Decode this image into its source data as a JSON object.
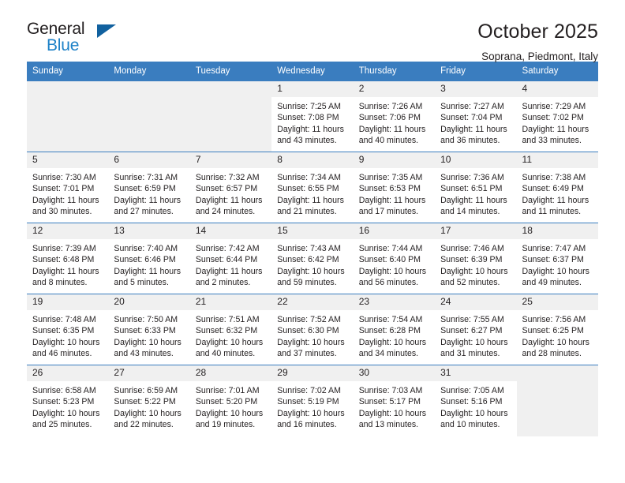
{
  "brand": {
    "word_one": "General",
    "word_two": "Blue",
    "triangle_icon": "triangle-icon"
  },
  "header": {
    "title": "October 2025",
    "location": "Soprana, Piedmont, Italy"
  },
  "colors": {
    "header_blue": "#3a7dbf",
    "brand_blue": "#1d81c7",
    "triangle_blue": "#11619f",
    "cell_band_gray": "#f0f0f0",
    "text": "#231f20"
  },
  "weekdays": [
    "Sunday",
    "Monday",
    "Tuesday",
    "Wednesday",
    "Thursday",
    "Friday",
    "Saturday"
  ],
  "labels": {
    "sunrise_prefix": "Sunrise:",
    "sunset_prefix": "Sunset:",
    "daylight_prefix": "Daylight:"
  },
  "weeks": [
    [
      {
        "day": "",
        "empty": true
      },
      {
        "day": "",
        "empty": true
      },
      {
        "day": "",
        "empty": true
      },
      {
        "day": "1",
        "sunrise": "Sunrise: 7:25 AM",
        "sunset": "Sunset: 7:08 PM",
        "daylight_line1": "Daylight: 11 hours",
        "daylight_line2": "and 43 minutes."
      },
      {
        "day": "2",
        "sunrise": "Sunrise: 7:26 AM",
        "sunset": "Sunset: 7:06 PM",
        "daylight_line1": "Daylight: 11 hours",
        "daylight_line2": "and 40 minutes."
      },
      {
        "day": "3",
        "sunrise": "Sunrise: 7:27 AM",
        "sunset": "Sunset: 7:04 PM",
        "daylight_line1": "Daylight: 11 hours",
        "daylight_line2": "and 36 minutes."
      },
      {
        "day": "4",
        "sunrise": "Sunrise: 7:29 AM",
        "sunset": "Sunset: 7:02 PM",
        "daylight_line1": "Daylight: 11 hours",
        "daylight_line2": "and 33 minutes."
      }
    ],
    [
      {
        "day": "5",
        "sunrise": "Sunrise: 7:30 AM",
        "sunset": "Sunset: 7:01 PM",
        "daylight_line1": "Daylight: 11 hours",
        "daylight_line2": "and 30 minutes."
      },
      {
        "day": "6",
        "sunrise": "Sunrise: 7:31 AM",
        "sunset": "Sunset: 6:59 PM",
        "daylight_line1": "Daylight: 11 hours",
        "daylight_line2": "and 27 minutes."
      },
      {
        "day": "7",
        "sunrise": "Sunrise: 7:32 AM",
        "sunset": "Sunset: 6:57 PM",
        "daylight_line1": "Daylight: 11 hours",
        "daylight_line2": "and 24 minutes."
      },
      {
        "day": "8",
        "sunrise": "Sunrise: 7:34 AM",
        "sunset": "Sunset: 6:55 PM",
        "daylight_line1": "Daylight: 11 hours",
        "daylight_line2": "and 21 minutes."
      },
      {
        "day": "9",
        "sunrise": "Sunrise: 7:35 AM",
        "sunset": "Sunset: 6:53 PM",
        "daylight_line1": "Daylight: 11 hours",
        "daylight_line2": "and 17 minutes."
      },
      {
        "day": "10",
        "sunrise": "Sunrise: 7:36 AM",
        "sunset": "Sunset: 6:51 PM",
        "daylight_line1": "Daylight: 11 hours",
        "daylight_line2": "and 14 minutes."
      },
      {
        "day": "11",
        "sunrise": "Sunrise: 7:38 AM",
        "sunset": "Sunset: 6:49 PM",
        "daylight_line1": "Daylight: 11 hours",
        "daylight_line2": "and 11 minutes."
      }
    ],
    [
      {
        "day": "12",
        "sunrise": "Sunrise: 7:39 AM",
        "sunset": "Sunset: 6:48 PM",
        "daylight_line1": "Daylight: 11 hours",
        "daylight_line2": "and 8 minutes."
      },
      {
        "day": "13",
        "sunrise": "Sunrise: 7:40 AM",
        "sunset": "Sunset: 6:46 PM",
        "daylight_line1": "Daylight: 11 hours",
        "daylight_line2": "and 5 minutes."
      },
      {
        "day": "14",
        "sunrise": "Sunrise: 7:42 AM",
        "sunset": "Sunset: 6:44 PM",
        "daylight_line1": "Daylight: 11 hours",
        "daylight_line2": "and 2 minutes."
      },
      {
        "day": "15",
        "sunrise": "Sunrise: 7:43 AM",
        "sunset": "Sunset: 6:42 PM",
        "daylight_line1": "Daylight: 10 hours",
        "daylight_line2": "and 59 minutes."
      },
      {
        "day": "16",
        "sunrise": "Sunrise: 7:44 AM",
        "sunset": "Sunset: 6:40 PM",
        "daylight_line1": "Daylight: 10 hours",
        "daylight_line2": "and 56 minutes."
      },
      {
        "day": "17",
        "sunrise": "Sunrise: 7:46 AM",
        "sunset": "Sunset: 6:39 PM",
        "daylight_line1": "Daylight: 10 hours",
        "daylight_line2": "and 52 minutes."
      },
      {
        "day": "18",
        "sunrise": "Sunrise: 7:47 AM",
        "sunset": "Sunset: 6:37 PM",
        "daylight_line1": "Daylight: 10 hours",
        "daylight_line2": "and 49 minutes."
      }
    ],
    [
      {
        "day": "19",
        "sunrise": "Sunrise: 7:48 AM",
        "sunset": "Sunset: 6:35 PM",
        "daylight_line1": "Daylight: 10 hours",
        "daylight_line2": "and 46 minutes."
      },
      {
        "day": "20",
        "sunrise": "Sunrise: 7:50 AM",
        "sunset": "Sunset: 6:33 PM",
        "daylight_line1": "Daylight: 10 hours",
        "daylight_line2": "and 43 minutes."
      },
      {
        "day": "21",
        "sunrise": "Sunrise: 7:51 AM",
        "sunset": "Sunset: 6:32 PM",
        "daylight_line1": "Daylight: 10 hours",
        "daylight_line2": "and 40 minutes."
      },
      {
        "day": "22",
        "sunrise": "Sunrise: 7:52 AM",
        "sunset": "Sunset: 6:30 PM",
        "daylight_line1": "Daylight: 10 hours",
        "daylight_line2": "and 37 minutes."
      },
      {
        "day": "23",
        "sunrise": "Sunrise: 7:54 AM",
        "sunset": "Sunset: 6:28 PM",
        "daylight_line1": "Daylight: 10 hours",
        "daylight_line2": "and 34 minutes."
      },
      {
        "day": "24",
        "sunrise": "Sunrise: 7:55 AM",
        "sunset": "Sunset: 6:27 PM",
        "daylight_line1": "Daylight: 10 hours",
        "daylight_line2": "and 31 minutes."
      },
      {
        "day": "25",
        "sunrise": "Sunrise: 7:56 AM",
        "sunset": "Sunset: 6:25 PM",
        "daylight_line1": "Daylight: 10 hours",
        "daylight_line2": "and 28 minutes."
      }
    ],
    [
      {
        "day": "26",
        "sunrise": "Sunrise: 6:58 AM",
        "sunset": "Sunset: 5:23 PM",
        "daylight_line1": "Daylight: 10 hours",
        "daylight_line2": "and 25 minutes."
      },
      {
        "day": "27",
        "sunrise": "Sunrise: 6:59 AM",
        "sunset": "Sunset: 5:22 PM",
        "daylight_line1": "Daylight: 10 hours",
        "daylight_line2": "and 22 minutes."
      },
      {
        "day": "28",
        "sunrise": "Sunrise: 7:01 AM",
        "sunset": "Sunset: 5:20 PM",
        "daylight_line1": "Daylight: 10 hours",
        "daylight_line2": "and 19 minutes."
      },
      {
        "day": "29",
        "sunrise": "Sunrise: 7:02 AM",
        "sunset": "Sunset: 5:19 PM",
        "daylight_line1": "Daylight: 10 hours",
        "daylight_line2": "and 16 minutes."
      },
      {
        "day": "30",
        "sunrise": "Sunrise: 7:03 AM",
        "sunset": "Sunset: 5:17 PM",
        "daylight_line1": "Daylight: 10 hours",
        "daylight_line2": "and 13 minutes."
      },
      {
        "day": "31",
        "sunrise": "Sunrise: 7:05 AM",
        "sunset": "Sunset: 5:16 PM",
        "daylight_line1": "Daylight: 10 hours",
        "daylight_line2": "and 10 minutes."
      },
      {
        "day": "",
        "empty": true
      }
    ]
  ]
}
